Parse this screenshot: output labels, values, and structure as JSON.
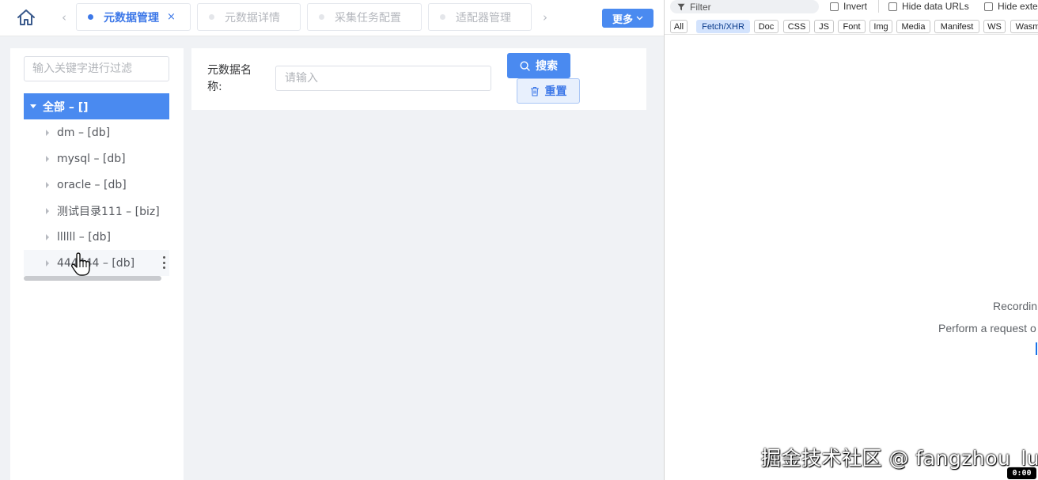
{
  "tabs_bar": {
    "home_icon": "home-icon",
    "tabs": [
      {
        "label": "元数据管理",
        "active": true,
        "closable": true
      },
      {
        "label": "元数据详情",
        "active": false
      },
      {
        "label": "采集任务配置",
        "active": false
      },
      {
        "label": "适配器管理",
        "active": false
      }
    ],
    "close_glyph": "×",
    "prev_glyph": "‹",
    "next_glyph": "›",
    "more_label": "更多"
  },
  "tree_panel": {
    "filter_placeholder": "输入关键字进行过滤",
    "root_label": "全部 – []",
    "nodes": [
      {
        "label": "dm – [db]"
      },
      {
        "label": "mysql – [db]"
      },
      {
        "label": "oracle – [db]"
      },
      {
        "label": "测试目录111 – [biz]"
      },
      {
        "label": "llllll – [db]"
      },
      {
        "label": "444444 – [db]",
        "hovered": true
      }
    ]
  },
  "search_panel": {
    "field_label": "元数据名称:",
    "name_placeholder": "请输入",
    "search_label": "搜索",
    "reset_label": "重置"
  },
  "devtools": {
    "filter_label": "Filter",
    "invert_label": "Invert",
    "hide_data_urls_label": "Hide data URLs",
    "hide_ext_label": "Hide exte",
    "type_filters": [
      "All",
      "Fetch/XHR",
      "Doc",
      "CSS",
      "JS",
      "Font",
      "Img",
      "Media",
      "Manifest",
      "WS",
      "Wasm"
    ],
    "active_filter": "Fetch/XHR",
    "recording_text": "Recordin",
    "perform_text": "Perform a request o"
  },
  "overlay": {
    "watermark": "掘金技术社区 @ fangzhou_lu",
    "timer": "0:00"
  },
  "colors": {
    "accent": "#4a8af0",
    "active_tab_text": "#3d78e8",
    "page_bg": "#f0f2f5"
  }
}
